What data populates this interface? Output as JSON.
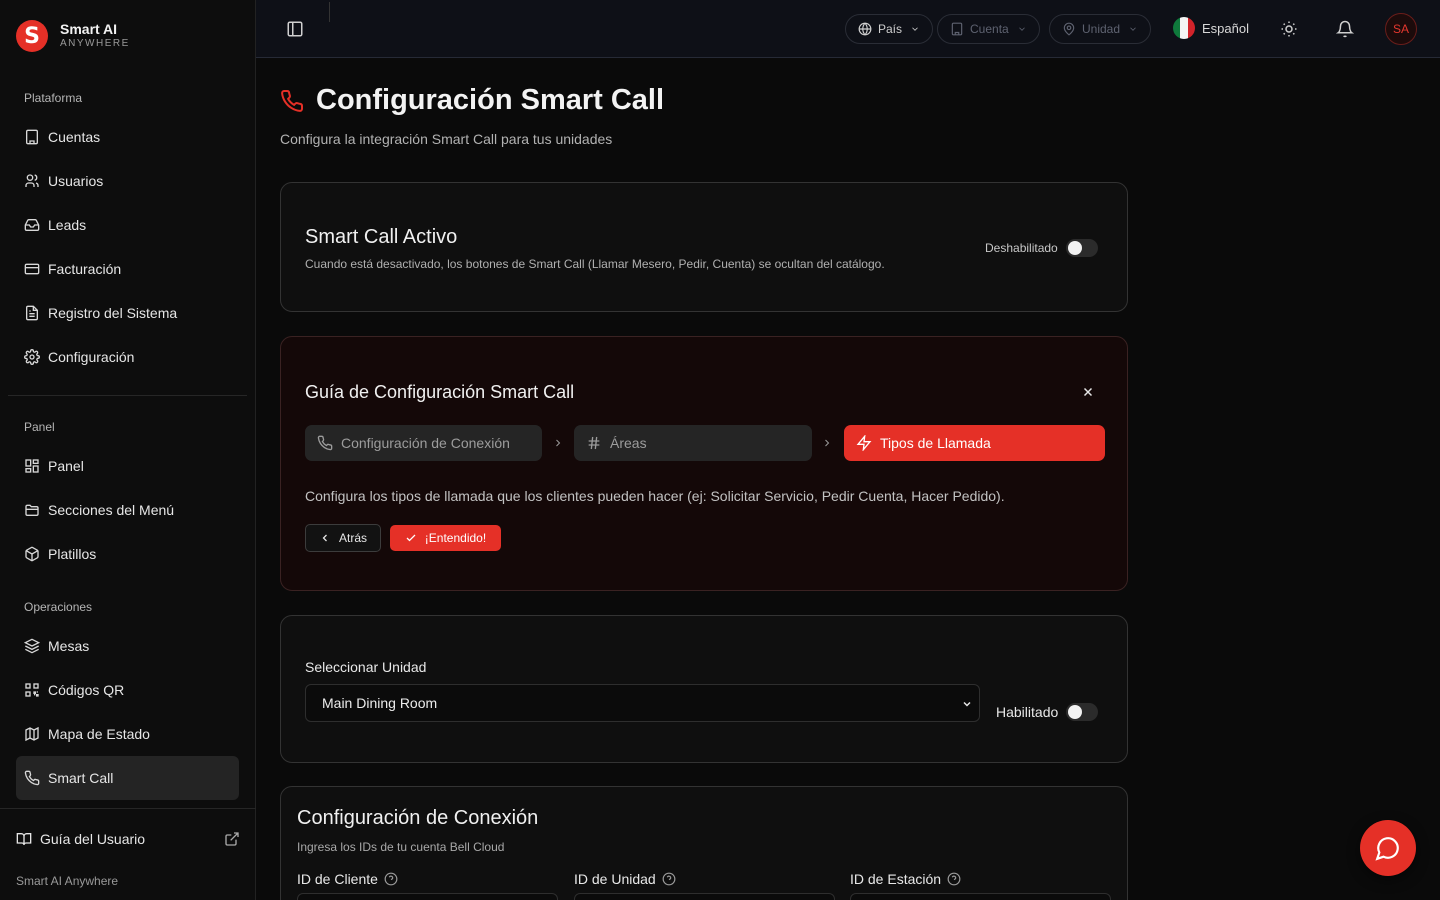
{
  "brand": {
    "name": "Smart AI",
    "sub": "ANYWHERE",
    "logo_letter": "S",
    "accent": "#e53027"
  },
  "sidebar": {
    "sections": [
      {
        "label": "Plataforma",
        "items": [
          {
            "label": "Cuentas",
            "icon": "building-icon"
          },
          {
            "label": "Usuarios",
            "icon": "users-icon"
          },
          {
            "label": "Leads",
            "icon": "inbox-icon"
          },
          {
            "label": "Facturación",
            "icon": "credit-card-icon"
          },
          {
            "label": "Registro del Sistema",
            "icon": "file-text-icon"
          },
          {
            "label": "Configuración",
            "icon": "gear-icon"
          }
        ]
      },
      {
        "label": "Panel",
        "items": [
          {
            "label": "Panel",
            "icon": "grid-icon"
          },
          {
            "label": "Secciones del Menú",
            "icon": "folder-icon"
          },
          {
            "label": "Platillos",
            "icon": "box-icon"
          }
        ]
      },
      {
        "label": "Operaciones",
        "items": [
          {
            "label": "Mesas",
            "icon": "layers-icon"
          },
          {
            "label": "Códigos QR",
            "icon": "qr-code-icon"
          },
          {
            "label": "Mapa de Estado",
            "icon": "map-icon"
          },
          {
            "label": "Smart Call",
            "icon": "phone-icon",
            "active": true
          }
        ]
      }
    ],
    "guide_label": "Guía del Usuario",
    "footer": "Smart AI Anywhere"
  },
  "header": {
    "country": "País",
    "account": "Cuenta",
    "unit": "Unidad",
    "language": "Español",
    "avatar_initials": "SA"
  },
  "page": {
    "title": "Configuración Smart Call",
    "subtitle": "Configura la integración Smart Call para tus unidades"
  },
  "active_card": {
    "title": "Smart Call Activo",
    "description": "Cuando está desactivado, los botones de Smart Call (Llamar Mesero, Pedir, Cuenta) se ocultan del catálogo.",
    "status_label": "Deshabilitado",
    "enabled": false
  },
  "guide": {
    "title": "Guía de Configuración Smart Call",
    "steps": [
      {
        "label": "Configuración de Conexión",
        "icon": "phone-icon"
      },
      {
        "label": "Áreas",
        "icon": "hash-icon"
      },
      {
        "label": "Tipos de Llamada",
        "icon": "zap-icon",
        "active": true
      }
    ],
    "description": "Configura los tipos de llamada que los clientes pueden hacer (ej: Solicitar Servicio, Pedir Cuenta, Hacer Pedido).",
    "back_label": "Atrás",
    "ok_label": "¡Entendido!"
  },
  "unit_card": {
    "label": "Seleccionar Unidad",
    "selected_unit": "Main Dining Room",
    "status_label": "Habilitado",
    "enabled": false
  },
  "connection": {
    "title": "Configuración de Conexión",
    "description": "Ingresa los IDs de tu cuenta Bell Cloud",
    "fields": [
      {
        "label": "ID de Cliente",
        "value": ""
      },
      {
        "label": "ID de Unidad",
        "value": ""
      },
      {
        "label": "ID de Estación",
        "value": ""
      }
    ]
  }
}
